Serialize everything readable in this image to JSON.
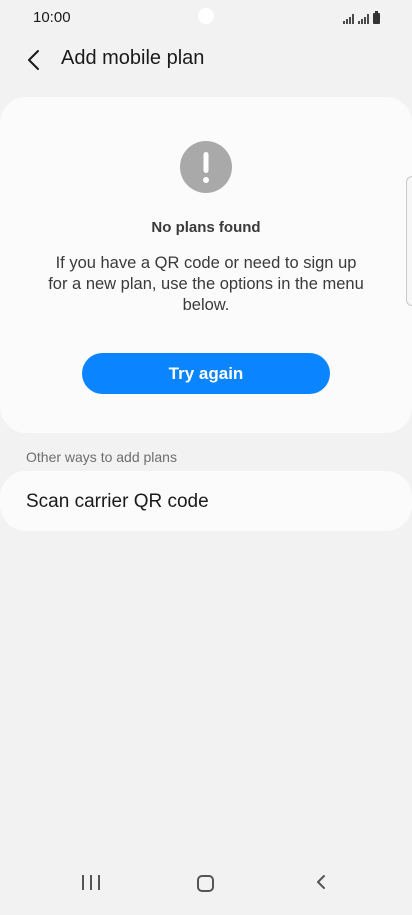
{
  "status_bar": {
    "time": "10:00"
  },
  "app_bar": {
    "title": "Add mobile plan",
    "back_icon": "chevron-left-icon"
  },
  "empty_state": {
    "icon": "exclamation-circle-icon",
    "title": "No plans found",
    "message": "If you have a QR code or need to sign up for a new plan, use the options in the menu below.",
    "try_again_label": "Try again"
  },
  "other_ways": {
    "header": "Other ways to add plans",
    "options": [
      {
        "label": "Scan carrier QR code"
      }
    ]
  },
  "colors": {
    "accent": "#0a84ff",
    "background": "#f2f2f2",
    "card": "#fbfbfb",
    "icon_gray": "#a9a9a9"
  },
  "nav_bar": {
    "recents_icon": "recents-icon",
    "home_icon": "home-icon",
    "back_icon": "back-icon"
  }
}
